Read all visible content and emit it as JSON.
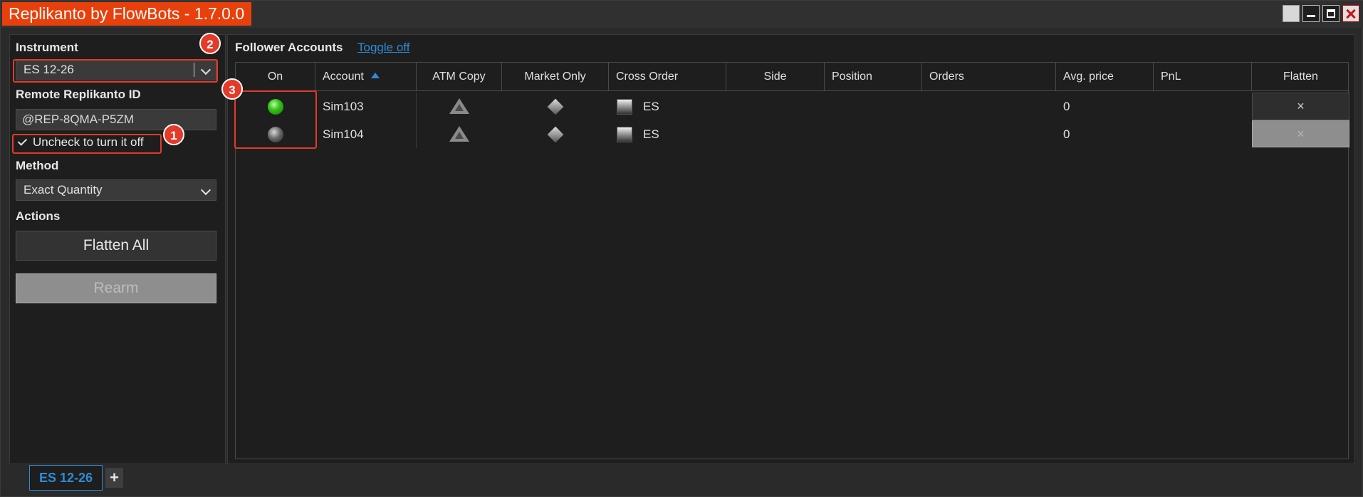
{
  "window": {
    "title": "Replikanto by FlowBots - 1.7.0.0"
  },
  "left": {
    "instrument_label": "Instrument",
    "instrument_value": "ES 12-26",
    "remote_id_label": "Remote Replikanto ID",
    "remote_id_value": "@REP-8QMA-P5ZM",
    "checkbox_label": "Uncheck to turn it off",
    "method_label": "Method",
    "method_value": "Exact Quantity",
    "actions_label": "Actions",
    "flatten_all_label": "Flatten All",
    "rearm_label": "Rearm"
  },
  "annotations": {
    "badge1": "1",
    "badge2": "2",
    "badge3": "3",
    "highlight_color": "#e33a2a"
  },
  "right": {
    "title": "Follower Accounts",
    "toggle_link": "Toggle off",
    "columns": [
      "On",
      "Account",
      "ATM Copy",
      "Market Only",
      "Cross Order",
      "Side",
      "Position",
      "Orders",
      "Avg. price",
      "PnL",
      "Flatten"
    ],
    "rows": [
      {
        "on": true,
        "account": "Sim103",
        "cross_order": "ES",
        "side": "",
        "position": "",
        "orders": "",
        "avg_price": "0",
        "pnl": "",
        "flatten": "×",
        "flatten_enabled": true
      },
      {
        "on": false,
        "account": "Sim104",
        "cross_order": "ES",
        "side": "",
        "position": "",
        "orders": "",
        "avg_price": "0",
        "pnl": "",
        "flatten": "×",
        "flatten_enabled": false
      }
    ]
  },
  "tabs": {
    "active": "ES 12-26",
    "add": "+"
  },
  "colors": {
    "accent": "#2e8bd8",
    "title_bg": "#e8400c",
    "led_on": "#36c21a"
  },
  "icons": {
    "on_led": "green-led-icon",
    "off_led": "gray-led-icon",
    "atm": "triangle-icon",
    "market": "diamond-icon",
    "cross": "square-icon"
  }
}
